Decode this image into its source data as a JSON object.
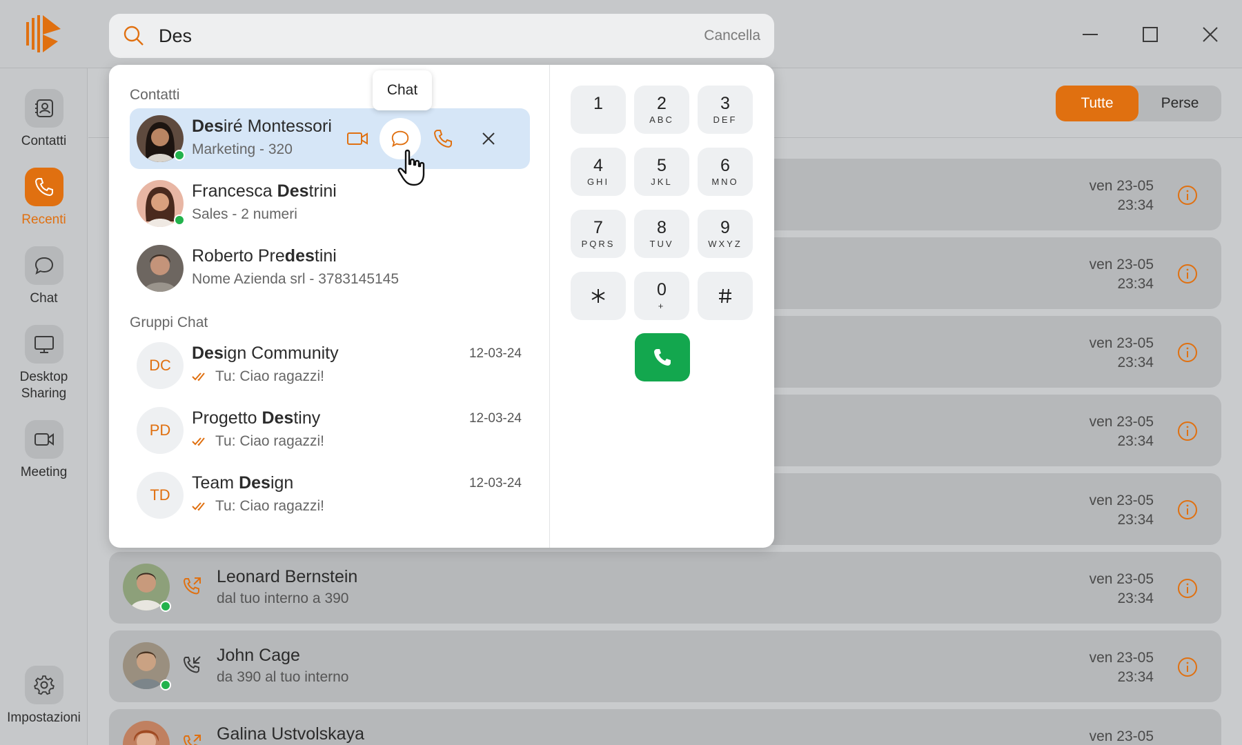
{
  "window": {
    "controls": [
      "minimize",
      "maximize",
      "close"
    ]
  },
  "sidebar": {
    "items": [
      {
        "label": "Contatti",
        "icon": "contacts-icon",
        "active": false
      },
      {
        "label": "Recenti",
        "icon": "phone-icon",
        "active": true
      },
      {
        "label": "Chat",
        "icon": "chat-bubble-icon",
        "active": false
      },
      {
        "label": "Desktop Sharing",
        "icon": "monitor-icon",
        "active": false
      },
      {
        "label": "Meeting",
        "icon": "video-camera-icon",
        "active": false
      },
      {
        "label": "Impostazioni",
        "icon": "gear-icon",
        "active": false
      }
    ]
  },
  "search": {
    "value": "Des",
    "cancel_label": "Cancella"
  },
  "results": {
    "contacts_title": "Contatti",
    "contacts": [
      {
        "name_match": "Des",
        "name_rest": "iré Montessori",
        "subtitle": "Marketing - 320",
        "online": true,
        "selected": true
      },
      {
        "name_pre": "Francesca ",
        "name_match": "Des",
        "name_rest": "trini",
        "subtitle": "Sales - 2 numeri",
        "online": true
      },
      {
        "name_pre": "Roberto Pre",
        "name_match": "des",
        "name_rest": "tini",
        "subtitle": "Nome Azienda srl - 3783145145",
        "online": false
      }
    ],
    "groups_title": "Gruppi Chat",
    "groups": [
      {
        "initials": "DC",
        "name_match": "Des",
        "name_rest": "ign Community",
        "last_message": "Tu: Ciao ragazzi!",
        "date": "12-03-24"
      },
      {
        "initials": "PD",
        "name_pre": "Progetto ",
        "name_match": "Des",
        "name_rest": "tiny",
        "last_message": "Tu: Ciao ragazzi!",
        "date": "12-03-24"
      },
      {
        "initials": "TD",
        "name_pre": "Team ",
        "name_match": "Des",
        "name_rest": "ign",
        "last_message": "Tu: Ciao ragazzi!",
        "date": "12-03-24"
      }
    ],
    "tooltip": "Chat"
  },
  "dialpad": {
    "keys": [
      {
        "digit": "1",
        "letters": ""
      },
      {
        "digit": "2",
        "letters": "ABC"
      },
      {
        "digit": "3",
        "letters": "DEF"
      },
      {
        "digit": "4",
        "letters": "GHI"
      },
      {
        "digit": "5",
        "letters": "JKL"
      },
      {
        "digit": "6",
        "letters": "MNO"
      },
      {
        "digit": "7",
        "letters": "PQRS"
      },
      {
        "digit": "8",
        "letters": "TUV"
      },
      {
        "digit": "9",
        "letters": "WXYZ"
      },
      {
        "digit": "0",
        "letters": "+"
      }
    ]
  },
  "recents": {
    "filters": [
      "Tutte",
      "Perse"
    ],
    "active_filter": "Tutte",
    "calls": [
      {
        "name": "Leonard Bernstein",
        "subtitle": "dal tuo interno a 390",
        "date": "ven 23-05",
        "time": "23:34",
        "direction": "outgoing"
      },
      {
        "name": "John Cage",
        "subtitle": "da 390 al tuo interno",
        "date": "ven 23-05",
        "time": "23:34",
        "direction": "incoming"
      },
      {
        "name": "Galina Ustvolskaya",
        "subtitle": "",
        "date": "ven 23-05",
        "time": "",
        "direction": "outgoing"
      }
    ],
    "hidden_row_times": [
      {
        "date": "ven 23-05",
        "time": "23:34"
      },
      {
        "date": "ven 23-05",
        "time": "23:34"
      },
      {
        "date": "ven 23-05",
        "time": "23:34"
      },
      {
        "date": "ven 23-05",
        "time": "23:34"
      },
      {
        "date": "ven 23-05",
        "time": "23:34"
      }
    ]
  },
  "colors": {
    "accent": "#e07010",
    "call_green": "#13a74e",
    "presence_online": "#22b24c",
    "selected_row": "#d6e6f7"
  }
}
